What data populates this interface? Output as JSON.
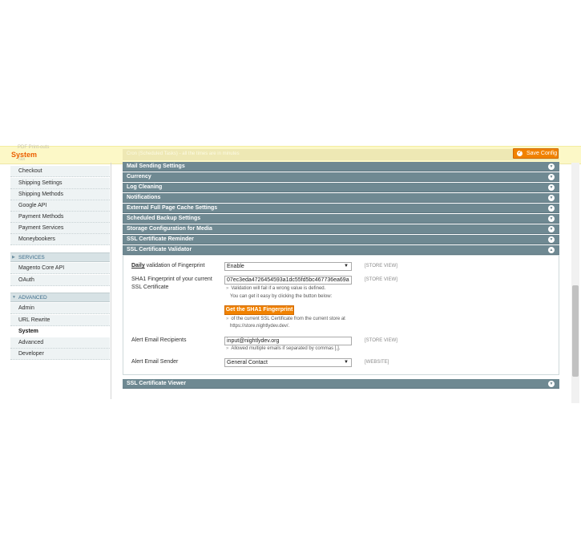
{
  "header": {
    "title": "System",
    "ghost_top": "PDF Print-outs",
    "ghost_bottom": "Tax",
    "ghost_section": "Cron (Scheduled Tasks) - all the times are in minutes",
    "save_label": "Save Config"
  },
  "sidebar": {
    "items_top": [
      "Checkout",
      "Shipping Settings",
      "Shipping Methods",
      "Google API",
      "Payment Methods",
      "Payment Services",
      "Moneybookers"
    ],
    "services": {
      "heading": "SERVICES",
      "items": [
        "Magento Core API",
        "OAuth"
      ]
    },
    "advanced": {
      "heading": "ADVANCED",
      "items": [
        "Admin",
        "URL Rewrite",
        "System",
        "Advanced",
        "Developer"
      ]
    }
  },
  "sections": [
    "Mail Sending Settings",
    "Currency",
    "Log Cleaning",
    "Notifications",
    "External Full Page Cache Settings",
    "Scheduled Backup Settings",
    "Storage Configuration for Media",
    "SSL Certificate Reminder",
    "SSL Certificate Validator"
  ],
  "validator": {
    "daily_label_bold": "Daily",
    "daily_label_rest": " validation of Fingerprint",
    "daily_value": "Enable",
    "daily_scope": "[STORE VIEW]",
    "sha_label_1": "SHA1 Fingerprint of your current",
    "sha_label_2": "SSL Certificate",
    "sha_value": "07ec3eda4726454593a1dc55fd5bc467736ea69a",
    "sha_scope": "[STORE VIEW]",
    "sha_note_1": "Validation will fail if a wrong value is defined.",
    "sha_note_2": "You can get it easy by clicking the button below:",
    "sha_button": "Get the SHA1 Fingerprint",
    "btn_note_1": "of the current SSL Certificate from the current store at",
    "btn_note_2": "https://store.nightlydev.dev/.",
    "email_label": "Alert Email Recipients",
    "email_value": "input@nightlydev.org",
    "email_scope": "[STORE VIEW]",
    "email_note": "Allowed multiple emails if separated by commas [,].",
    "sender_label": "Alert Email Sender",
    "sender_value": "General Contact",
    "sender_scope": "[WEBSITE]"
  },
  "viewer_section": "SSL Certificate Viewer",
  "colors": {
    "accent": "#f18200",
    "section": "#6f8992",
    "header": "#fcf8c7"
  }
}
